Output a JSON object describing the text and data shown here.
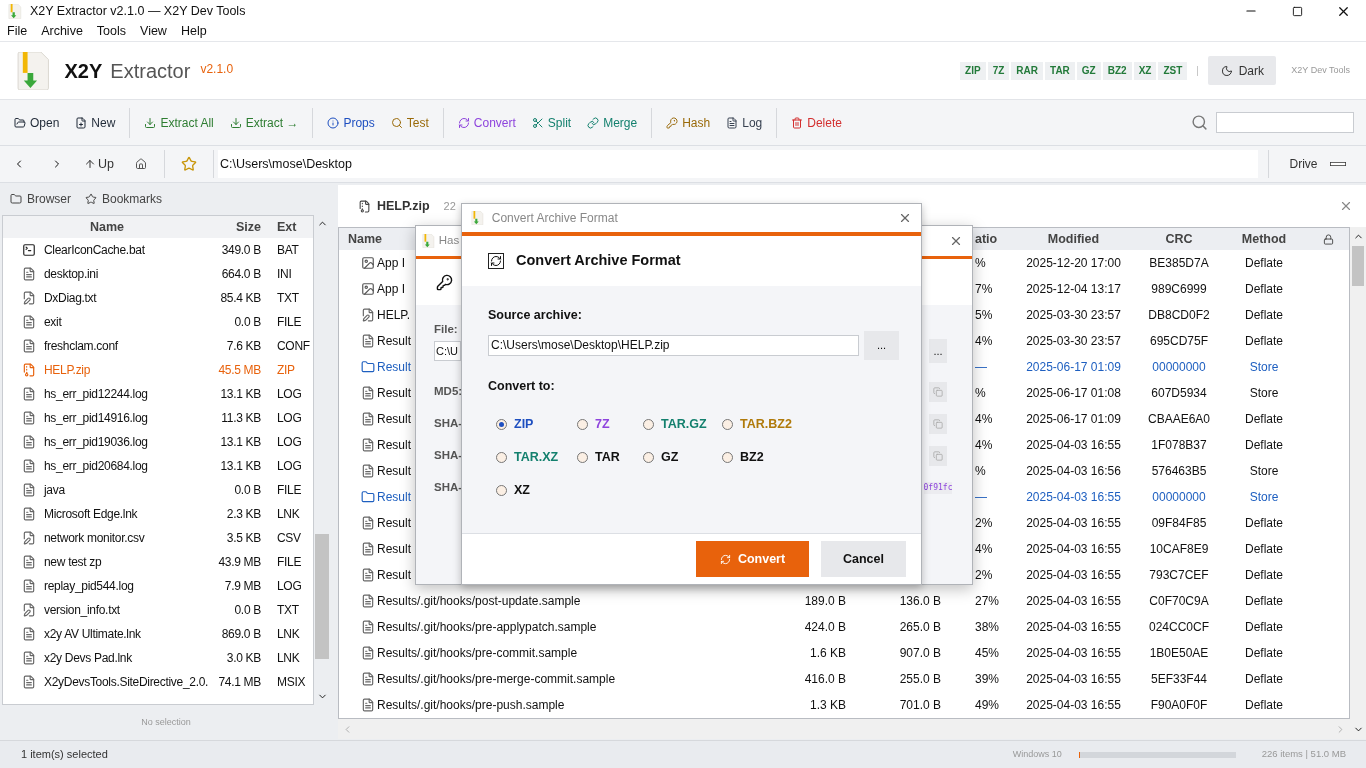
{
  "window": {
    "title": "X2Y Extractor v2.1.0 — X2Y Dev Tools"
  },
  "menu": [
    "File",
    "Archive",
    "Tools",
    "View",
    "Help"
  ],
  "brand": {
    "name": "X2Y",
    "product": "Extractor",
    "version": "v2.1.0",
    "formats": [
      "ZIP",
      "7Z",
      "RAR",
      "TAR",
      "GZ",
      "BZ2",
      "XZ",
      "ZST"
    ],
    "theme_button": "Dark",
    "vendor": "X2Y Dev Tools"
  },
  "toolbar": {
    "groups": [
      {
        "items": [
          {
            "label": "Open",
            "color": "#1f2937"
          },
          {
            "label": "New",
            "color": "#1f2937"
          }
        ]
      },
      {
        "items": [
          {
            "label": "Extract All",
            "color": "#2e7d32"
          },
          {
            "label": "Extract →",
            "color": "#2e7d32"
          }
        ]
      },
      {
        "items": [
          {
            "label": "Props",
            "color": "#1e4fc0"
          },
          {
            "label": "Test",
            "color": "#9a6a0a"
          }
        ]
      },
      {
        "items": [
          {
            "label": "Convert",
            "color": "#8e44dd"
          },
          {
            "label": "Split",
            "color": "#13806e"
          },
          {
            "label": "Merge",
            "color": "#13806e"
          }
        ]
      },
      {
        "items": [
          {
            "label": "Hash",
            "color": "#9a6a0a"
          },
          {
            "label": "Log",
            "color": "#374151"
          }
        ]
      },
      {
        "items": [
          {
            "label": "Delete",
            "color": "#d32f2f"
          }
        ]
      }
    ]
  },
  "address": {
    "up": "Up",
    "path": "C:\\Users\\mose\\Desktop",
    "drive": "Drive"
  },
  "sidebar": {
    "tabs": [
      "Browser",
      "Bookmarks"
    ],
    "columns": [
      "Name",
      "Size",
      "Ext"
    ],
    "files": [
      {
        "name": "ClearIconCache.bat",
        "size": "349.0 B",
        "ext": "BAT",
        "kind": "script",
        "selected": false
      },
      {
        "name": "desktop.ini",
        "size": "664.0 B",
        "ext": "INI",
        "kind": "doc",
        "selected": false
      },
      {
        "name": "DxDiag.txt",
        "size": "85.4 KB",
        "ext": "TXT",
        "kind": "note",
        "selected": false
      },
      {
        "name": "exit",
        "size": "0.0 B",
        "ext": "FILE",
        "kind": "doc",
        "selected": false
      },
      {
        "name": "freshclam.conf",
        "size": "7.6 KB",
        "ext": "CONF",
        "kind": "doc",
        "selected": false
      },
      {
        "name": "HELP.zip",
        "size": "45.5 MB",
        "ext": "ZIP",
        "kind": "archive",
        "selected": true
      },
      {
        "name": "hs_err_pid12244.log",
        "size": "13.1 KB",
        "ext": "LOG",
        "kind": "doc",
        "selected": false
      },
      {
        "name": "hs_err_pid14916.log",
        "size": "11.3 KB",
        "ext": "LOG",
        "kind": "doc",
        "selected": false
      },
      {
        "name": "hs_err_pid19036.log",
        "size": "13.1 KB",
        "ext": "LOG",
        "kind": "doc",
        "selected": false
      },
      {
        "name": "hs_err_pid20684.log",
        "size": "13.1 KB",
        "ext": "LOG",
        "kind": "doc",
        "selected": false
      },
      {
        "name": "java",
        "size": "0.0 B",
        "ext": "FILE",
        "kind": "doc",
        "selected": false
      },
      {
        "name": "Microsoft Edge.lnk",
        "size": "2.3 KB",
        "ext": "LNK",
        "kind": "doc",
        "selected": false
      },
      {
        "name": "network monitor.csv",
        "size": "3.5 KB",
        "ext": "CSV",
        "kind": "note",
        "selected": false
      },
      {
        "name": "new test zp",
        "size": "43.9 MB",
        "ext": "FILE",
        "kind": "doc",
        "selected": false
      },
      {
        "name": "replay_pid544.log",
        "size": "7.9 MB",
        "ext": "LOG",
        "kind": "doc",
        "selected": false
      },
      {
        "name": "version_info.txt",
        "size": "0.0 B",
        "ext": "TXT",
        "kind": "note",
        "selected": false
      },
      {
        "name": "x2y AV Ultimate.lnk",
        "size": "869.0 B",
        "ext": "LNK",
        "kind": "doc",
        "selected": false
      },
      {
        "name": "x2y Devs Pad.lnk",
        "size": "3.0 KB",
        "ext": "LNK",
        "kind": "doc",
        "selected": false
      },
      {
        "name": "X2yDevsTools.SiteDirective_2.0.",
        "size": "74.1 MB",
        "ext": "MSIX",
        "kind": "doc",
        "selected": false
      }
    ],
    "footer": "No selection"
  },
  "archive": {
    "title": "HELP.zip",
    "info": "22",
    "columns": [
      "Name",
      "atio",
      "Modified",
      "CRC",
      "Method"
    ],
    "rows": [
      {
        "kind": "image",
        "name": "App I",
        "ratio": "%",
        "modified": "2025-12-20 17:00",
        "crc": "BE385D7A",
        "method": "Deflate"
      },
      {
        "kind": "image",
        "name": "App I",
        "ratio": "7%",
        "modified": "2025-12-04 13:17",
        "crc": "989C6999",
        "method": "Deflate"
      },
      {
        "kind": "note",
        "name": "HELP.",
        "ratio": "5%",
        "modified": "2025-03-30 23:57",
        "crc": "DB8CD0F2",
        "method": "Deflate"
      },
      {
        "kind": "doc",
        "name": "Result",
        "ratio": "4%",
        "modified": "2025-03-30 23:57",
        "crc": "695CD75F",
        "method": "Deflate"
      },
      {
        "kind": "folder",
        "name": "Result",
        "ratio": "—",
        "modified": "2025-06-17 01:09",
        "crc": "00000000",
        "method": "Store"
      },
      {
        "kind": "doc",
        "name": "Result",
        "ratio": "%",
        "modified": "2025-06-17 01:08",
        "crc": "607D5934",
        "method": "Store"
      },
      {
        "kind": "doc",
        "name": "Result",
        "ratio": "4%",
        "modified": "2025-06-17 01:09",
        "crc": "CBAAE6A0",
        "method": "Deflate"
      },
      {
        "kind": "doc",
        "name": "Result",
        "ratio": "4%",
        "modified": "2025-04-03 16:55",
        "crc": "1F078B37",
        "method": "Deflate"
      },
      {
        "kind": "doc",
        "name": "Result",
        "ratio": "%",
        "modified": "2025-04-03 16:56",
        "crc": "576463B5",
        "method": "Store"
      },
      {
        "kind": "folder",
        "name": "Result",
        "ratio": "—",
        "modified": "2025-04-03 16:55",
        "crc": "00000000",
        "method": "Store"
      },
      {
        "kind": "doc",
        "name": "Result",
        "ratio": "2%",
        "modified": "2025-04-03 16:55",
        "crc": "09F84F85",
        "method": "Deflate"
      },
      {
        "kind": "doc",
        "name": "Result",
        "ratio": "4%",
        "modified": "2025-04-03 16:55",
        "crc": "10CAF8E9",
        "method": "Deflate"
      },
      {
        "kind": "doc",
        "name": "Result",
        "ratio": "2%",
        "modified": "2025-04-03 16:55",
        "crc": "793C7CEF",
        "method": "Deflate"
      },
      {
        "kind": "doc",
        "name": "Results/.git/hooks/post-update.sample",
        "size": "189.0 B",
        "packed": "136.0 B",
        "ratio": "27%",
        "modified": "2025-04-03 16:55",
        "crc": "C0F70C9A",
        "method": "Deflate"
      },
      {
        "kind": "doc",
        "name": "Results/.git/hooks/pre-applypatch.sample",
        "size": "424.0 B",
        "packed": "265.0 B",
        "ratio": "38%",
        "modified": "2025-04-03 16:55",
        "crc": "024CC0CF",
        "method": "Deflate"
      },
      {
        "kind": "doc",
        "name": "Results/.git/hooks/pre-commit.sample",
        "size": "1.6 KB",
        "packed": "907.0 B",
        "ratio": "45%",
        "modified": "2025-04-03 16:55",
        "crc": "1B0E50AE",
        "method": "Deflate"
      },
      {
        "kind": "doc",
        "name": "Results/.git/hooks/pre-merge-commit.sample",
        "size": "416.0 B",
        "packed": "255.0 B",
        "ratio": "39%",
        "modified": "2025-04-03 16:55",
        "crc": "5EF33F44",
        "method": "Deflate"
      },
      {
        "kind": "doc",
        "name": "Results/.git/hooks/pre-push.sample",
        "size": "1.3 KB",
        "packed": "701.0 B",
        "ratio": "49%",
        "modified": "2025-04-03 16:55",
        "crc": "F90A0F0F",
        "method": "Deflate"
      }
    ]
  },
  "hash_dialog": {
    "title": "Has",
    "file_label": "File:",
    "file_value": "C:\\U",
    "browse": "...",
    "labels": [
      "MD5:",
      "SHA-",
      "SHA-",
      "SHA-"
    ],
    "hash_fragment": "0f91fc"
  },
  "convert_dialog": {
    "title": "Convert Archive Format",
    "heading": "Convert Archive Format",
    "source_label": "Source archive:",
    "source_value": "C:\\Users\\mose\\Desktop\\HELP.zip",
    "browse": "...",
    "target_label": "Convert to:",
    "options": [
      {
        "label": "ZIP",
        "color": "#1e4fc0",
        "selected": true
      },
      {
        "label": "7Z",
        "color": "#8e44dd",
        "selected": false
      },
      {
        "label": "TAR.GZ",
        "color": "#13806e",
        "selected": false
      },
      {
        "label": "TAR.BZ2",
        "color": "#b07a0a",
        "selected": false
      },
      {
        "label": "TAR.XZ",
        "color": "#13806e",
        "selected": false
      },
      {
        "label": "TAR",
        "color": "#111111",
        "selected": false
      },
      {
        "label": "GZ",
        "color": "#111111",
        "selected": false
      },
      {
        "label": "BZ2",
        "color": "#111111",
        "selected": false
      },
      {
        "label": "XZ",
        "color": "#111111",
        "selected": false
      }
    ],
    "convert": "Convert",
    "cancel": "Cancel"
  },
  "status_bar": {
    "selection": "1 item(s) selected",
    "os": "Windows 10",
    "progress": {
      "level": 0.01
    },
    "summary": "226 items | 51.0 MB"
  }
}
